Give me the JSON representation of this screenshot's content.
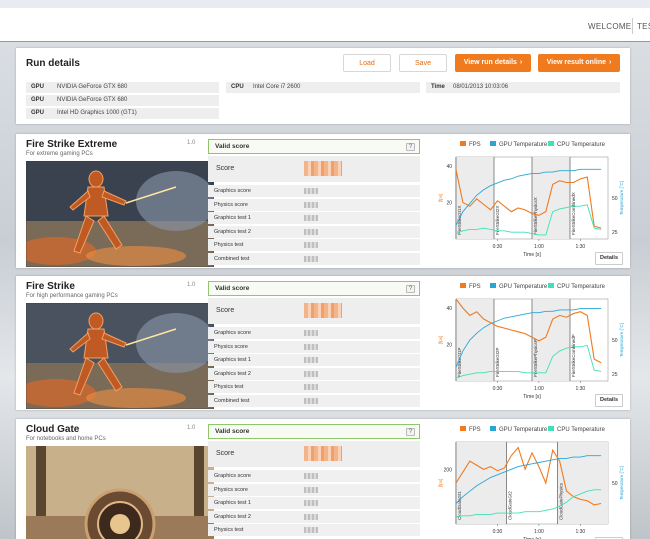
{
  "nav": {
    "welcome": "WELCOME",
    "tests": "TES"
  },
  "run_details": {
    "title": "Run details",
    "buttons": {
      "load": "Load",
      "save": "Save",
      "view_run": "View run details",
      "view_online": "View result online"
    },
    "gpu_label": "GPU",
    "gpus": [
      "NVIDIA GeForce GTX 680",
      "NVIDIA GeForce GTX 680",
      "Intel HD Graphics 1000 (GT1)"
    ],
    "cpu_label": "CPU",
    "cpu": "Intel Core i7 2600",
    "time_label": "Time",
    "time": "08/01/2013 10:03:06"
  },
  "common": {
    "version": "1.0",
    "valid": "Valid score",
    "help": "?",
    "score_label": "Score",
    "details": "Details",
    "legend": {
      "fps": "FPS",
      "gpu": "GPU Temperature",
      "cpu": "CPU Temperature"
    },
    "colors": {
      "fps": "#f07a1e",
      "gpu": "#2aa6d6",
      "cpu": "#3fe0b8",
      "accent": "#f07a1e",
      "valid_border": "#8fc86b"
    },
    "time_label": "Time [s]",
    "fps_axis_label": "[fps]",
    "temp_axis_label": "Temperature [°C]",
    "x_ticks": [
      "0:30",
      "1:00",
      "1:30"
    ]
  },
  "tests": [
    {
      "name": "Fire Strike Extreme",
      "subtitle": "For extreme gaming PCs",
      "rows": [
        "Graphics score",
        "Physics score",
        "Graphics test 1",
        "Graphics test 2",
        "Physics test",
        "Combined test"
      ],
      "chart_data": {
        "type": "line",
        "x_label": "Time [s]",
        "x_ticks": [
          "0:30",
          "1:00",
          "1:30"
        ],
        "fps_ticks": [
          20,
          40
        ],
        "temp_ticks": [
          25,
          50
        ],
        "segments": [
          "FireStrikeGt1X",
          "FireStrikeGt2X",
          "FireStrikePhysicsX",
          "FireStrikeCombinedX"
        ],
        "x": [
          0,
          5,
          10,
          15,
          20,
          25,
          30,
          35,
          40,
          45,
          50,
          55,
          60,
          65,
          70,
          75,
          80,
          85,
          90,
          95,
          100,
          105
        ],
        "series": [
          {
            "name": "FPS",
            "values": [
              38,
              20,
              18,
              22,
              19,
              16,
              21,
              18,
              15,
              17,
              16,
              14,
              13,
              15,
              30,
              32,
              31,
              31,
              33,
              34,
              7,
              6
            ]
          },
          {
            "name": "GPU Temperature",
            "values": [
              30,
              40,
              46,
              52,
              56,
              59,
              61,
              63,
              64,
              66,
              67,
              68,
              68,
              69,
              69,
              70,
              70,
              70,
              71,
              71,
              71,
              71
            ]
          },
          {
            "name": "CPU Temperature",
            "values": [
              24,
              26,
              27,
              27,
              28,
              27,
              26,
              26,
              25,
              25,
              25,
              24,
              23,
              23,
              40,
              42,
              43,
              44,
              44,
              45,
              28,
              27
            ]
          }
        ]
      }
    },
    {
      "name": "Fire Strike",
      "subtitle": "For high performance gaming PCs",
      "rows": [
        "Graphics score",
        "Physics score",
        "Graphics test 1",
        "Graphics test 2",
        "Physics test",
        "Combined test"
      ],
      "chart_data": {
        "type": "line",
        "x_label": "Time [s]",
        "x_ticks": [
          "0:30",
          "1:00",
          "1:30"
        ],
        "fps_ticks": [
          20,
          40
        ],
        "temp_ticks": [
          25,
          50
        ],
        "segments": [
          "FireStrikeGt1P",
          "FireStrikeGt2P",
          "FireStrikePhysicsP",
          "FireStrikeCombinedP"
        ],
        "x": [
          0,
          5,
          10,
          15,
          20,
          25,
          30,
          35,
          40,
          45,
          50,
          55,
          60,
          65,
          70,
          75,
          80,
          85,
          90,
          95,
          100,
          105
        ],
        "series": [
          {
            "name": "FPS",
            "values": [
              45,
              40,
              36,
              38,
              34,
              32,
              30,
              29,
              28,
              27,
              26,
              24,
              22,
              24,
              34,
              36,
              35,
              37,
              38,
              36,
              12,
              10
            ]
          },
          {
            "name": "GPU Temperature",
            "values": [
              30,
              42,
              50,
              55,
              59,
              62,
              64,
              66,
              67,
              68,
              69,
              70,
              70,
              71,
              71,
              72,
              72,
              72,
              73,
              73,
              73,
              73
            ]
          },
          {
            "name": "CPU Temperature",
            "values": [
              22,
              24,
              25,
              26,
              26,
              27,
              27,
              27,
              27,
              27,
              26,
              26,
              26,
              26,
              38,
              42,
              44,
              45,
              45,
              46,
              28,
              27
            ]
          }
        ]
      }
    },
    {
      "name": "Cloud Gate",
      "subtitle": "For notebooks and home PCs",
      "rows": [
        "Graphics score",
        "Physics score",
        "Graphics test 1",
        "Graphics test 2",
        "Physics test"
      ],
      "chart_data": {
        "type": "line",
        "x_label": "Time [s]",
        "x_ticks": [
          "0:30",
          "1:00",
          "1:30"
        ],
        "fps_ticks": [
          200
        ],
        "temp_ticks": [
          50
        ],
        "segments": [
          "CloudGateGt1",
          "CloudGateGt2",
          "CloudGatePhysics"
        ],
        "x": [
          0,
          5,
          10,
          15,
          20,
          25,
          30,
          35,
          40,
          45,
          50,
          55,
          60,
          65,
          70,
          75,
          80,
          85,
          90,
          95,
          100,
          105
        ],
        "series": [
          {
            "name": "FPS",
            "values": [
              150,
              190,
              230,
              215,
              200,
              210,
              195,
              205,
              250,
              280,
              200,
              260,
              210,
              150,
              270,
              230,
              120,
              100,
              90,
              85,
              70,
              75
            ]
          },
          {
            "name": "GPU Temperature",
            "values": [
              35,
              40,
              44,
              48,
              51,
              54,
              56,
              58,
              60,
              62,
              63,
              64,
              65,
              66,
              67,
              68,
              68,
              69,
              69,
              70,
              70,
              70
            ]
          },
          {
            "name": "CPU Temperature",
            "values": [
              25,
              26,
              26,
              27,
              27,
              27,
              28,
              28,
              28,
              28,
              29,
              29,
              29,
              30,
              31,
              33,
              36,
              40,
              42,
              44,
              45,
              45
            ]
          }
        ]
      }
    }
  ]
}
